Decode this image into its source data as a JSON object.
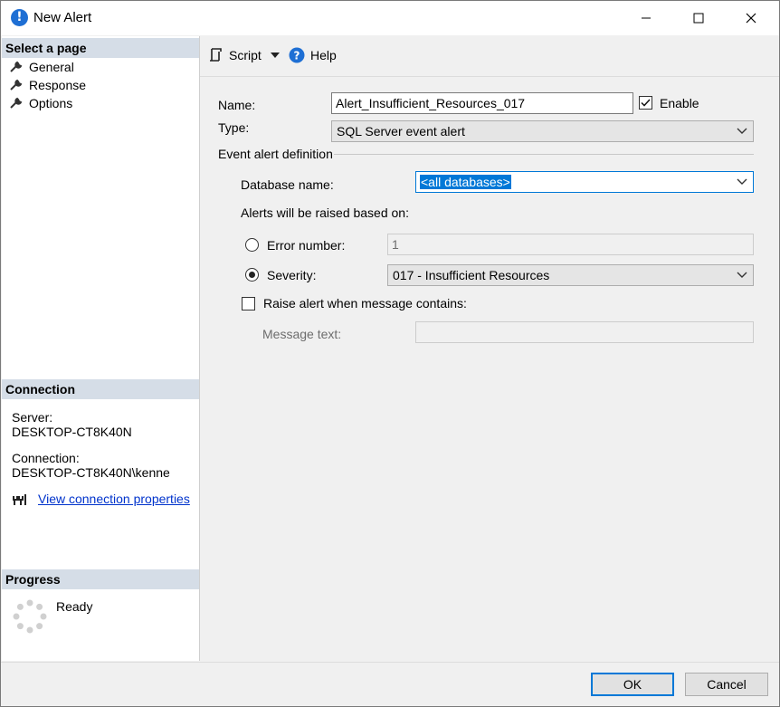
{
  "window": {
    "title": "New Alert",
    "icon": "alert-info-icon",
    "controls": [
      "minimize-icon",
      "maximize-icon",
      "close-icon"
    ]
  },
  "left_pane": {
    "select_page": {
      "header": "Select a page",
      "items": [
        {
          "label": "General",
          "icon": "wrench-icon"
        },
        {
          "label": "Response",
          "icon": "wrench-icon"
        },
        {
          "label": "Options",
          "icon": "wrench-icon"
        }
      ]
    },
    "connection": {
      "header": "Connection",
      "server_label": "Server:",
      "server_value": "DESKTOP-CT8K40N",
      "connection_label": "Connection:",
      "connection_value": "DESKTOP-CT8K40N\\kenne",
      "view_properties_link": "View connection properties"
    },
    "progress": {
      "header": "Progress",
      "status": "Ready"
    }
  },
  "toolbar": {
    "script_label": "Script",
    "help_label": "Help"
  },
  "form": {
    "name_label": "Name:",
    "name_value": "Alert_Insufficient_Resources_017",
    "enable_label": "Enable",
    "enable_checked": true,
    "type_label": "Type:",
    "type_value": "SQL Server event alert",
    "event_section_label": "Event alert definition",
    "database_label": "Database name:",
    "database_value": "<all databases>",
    "raised_based_on_label": "Alerts will be raised based on:",
    "error_number_label": "Error number:",
    "error_number_value": "1",
    "severity_label": "Severity:",
    "severity_value": "017 - Insufficient Resources",
    "severity_selected": true,
    "raise_when_contains_label": "Raise alert when message contains:",
    "raise_when_contains_checked": false,
    "message_text_label": "Message text:",
    "message_text_value": ""
  },
  "buttons": {
    "ok": "OK",
    "cancel": "Cancel"
  },
  "colors": {
    "accent": "#0078d7",
    "section_header_bg": "#d5dde7",
    "link": "#0033cc",
    "selection": "#0078d7"
  }
}
